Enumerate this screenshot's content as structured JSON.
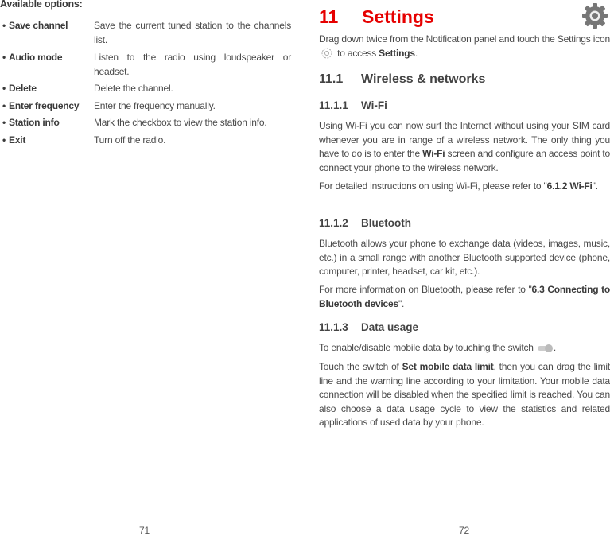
{
  "left_page": {
    "heading": "Available options:",
    "options": [
      {
        "label": "Save channel",
        "desc": "Save the current tuned station to the channels list."
      },
      {
        "label": "Audio mode",
        "desc": "Listen to the radio using loudspeaker or headset."
      },
      {
        "label": "Delete",
        "desc": "Delete the channel."
      },
      {
        "label": "Enter frequency",
        "desc": "Enter the frequency manually."
      },
      {
        "label": "Station info",
        "desc": "Mark the checkbox to view the station info."
      },
      {
        "label": "Exit",
        "desc": "Turn off the radio."
      }
    ],
    "page_number": "71"
  },
  "right_page": {
    "chapter_number": "11",
    "chapter_title": "Settings",
    "chapter_icon": "gear-icon",
    "intro_a": "Drag down twice from the Notification panel and touch the Settings icon ",
    "intro_b": " to access ",
    "intro_bold": "Settings",
    "intro_end": ".",
    "s1_num": "11.1",
    "s1_title": "Wireless & networks",
    "s111_num": "11.1.1",
    "s111_title": "Wi-Fi",
    "wifi_p1_a": "Using Wi-Fi you can now surf the Internet without using your SIM card whenever you are in range of a wireless network. The only thing you have to do is to enter the ",
    "wifi_p1_bold": "Wi-Fi",
    "wifi_p1_b": " screen and configure an access point to connect your phone to the wireless network.",
    "wifi_p2_a": "For detailed instructions on using Wi-Fi, please refer to \"",
    "wifi_p2_bold": "6.1.2 Wi-Fi",
    "wifi_p2_b": "\".",
    "s112_num": "11.1.2",
    "s112_title": "Bluetooth",
    "bt_p1": "Bluetooth allows your phone to exchange data (videos, images, music, etc.) in a small range with another Bluetooth supported device (phone, computer, printer, headset, car kit, etc.).",
    "bt_p2_a": "For more information on Bluetooth, please refer to \"",
    "bt_p2_bold": "6.3 Connecting to Bluetooth devices",
    "bt_p2_b": "\".",
    "s113_num": "11.1.3",
    "s113_title": "Data usage",
    "du_p1_a": "To enable/disable mobile data by touching the switch ",
    "du_p1_b": ".",
    "du_p2_a": "Touch the switch of ",
    "du_p2_bold": "Set mobile data limit",
    "du_p2_b": ", then you can drag the limit line and the warning line according to your limitation. Your mobile data connection will be disabled when the specified limit is reached. You can also choose a data usage cycle to view the statistics and related applications of used data by your phone.",
    "page_number": "72"
  },
  "colors": {
    "accent": "#e60000",
    "text": "#4a4a4a"
  }
}
